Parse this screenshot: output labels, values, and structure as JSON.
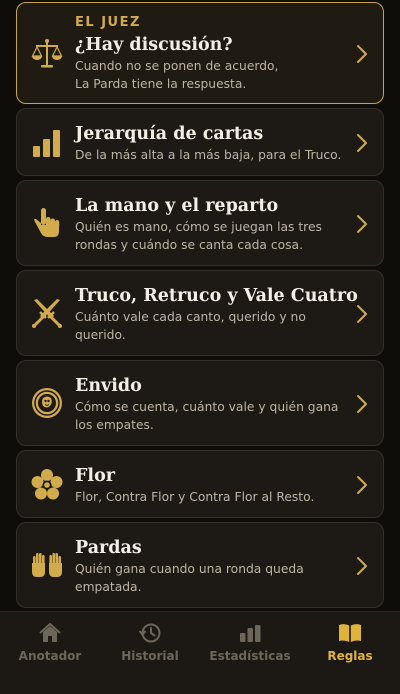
{
  "cards": [
    {
      "eyebrow": "EL JUEZ",
      "title": "¿Hay discusión?",
      "desc_line1": "Cuando no se ponen de acuerdo,",
      "desc_line2": "La Parda tiene la respuesta.",
      "icon": "scales-icon"
    },
    {
      "title": "Jerarquía de cartas",
      "desc_line1": "De la más alta a la más baja, para el Truco.",
      "icon": "bar-chart-icon"
    },
    {
      "title": "La mano y el reparto",
      "desc_line1": "Quién es mano, cómo se juegan las tres",
      "desc_line2": "rondas y cuándo se canta cada cosa.",
      "icon": "pointing-hand-icon"
    },
    {
      "title": "Truco, Retruco y Vale Cuatro",
      "desc_line1": "Cuánto vale cada canto, querido y no",
      "desc_line2": "querido.",
      "icon": "crossed-swords-icon"
    },
    {
      "title": "Envido",
      "desc_line1": "Cómo se cuenta, cuánto vale y quién gana",
      "desc_line2": "los empates.",
      "icon": "coin-icon"
    },
    {
      "title": "Flor",
      "desc_line1": "Flor, Contra Flor y Contra Flor al Resto.",
      "icon": "flower-icon"
    },
    {
      "title": "Pardas",
      "desc_line1": "Quién gana cuando una ronda queda",
      "desc_line2": "empatada.",
      "icon": "raised-hands-icon"
    }
  ],
  "tabs": [
    {
      "label": "Anotador",
      "icon": "house-icon",
      "active": false
    },
    {
      "label": "Historial",
      "icon": "history-icon",
      "active": false
    },
    {
      "label": "Estadísticas",
      "icon": "stats-icon",
      "active": false
    },
    {
      "label": "Reglas",
      "icon": "book-icon",
      "active": true
    }
  ],
  "colors": {
    "accent": "#d2ab4c",
    "background": "#0f0d0a",
    "card": "#1d1a15",
    "inactive_tab": "#6d665b"
  }
}
